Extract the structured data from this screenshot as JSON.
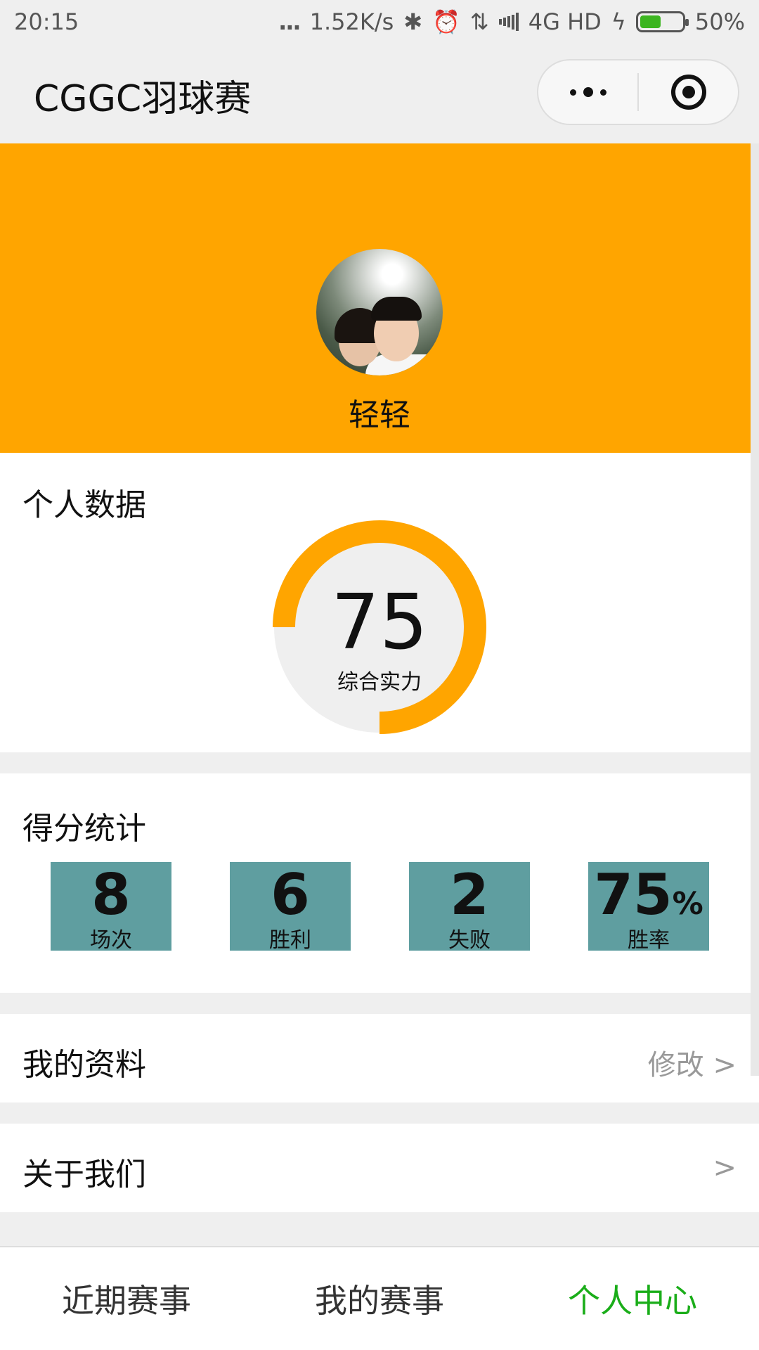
{
  "status_bar": {
    "time": "20:15",
    "dots": "...",
    "speed": "1.52K/s",
    "network": "4G HD",
    "battery": "50%",
    "battery_level": 0.5,
    "icons": [
      "bluetooth-icon",
      "alarm-icon",
      "data-arrows-icon",
      "signal-icon",
      "charging-icon",
      "battery-icon"
    ]
  },
  "header": {
    "title": "CGGC羽球赛",
    "capsule_icons": [
      "more-icon",
      "close-mini-program-icon"
    ]
  },
  "profile": {
    "name": "轻轻",
    "banner_color": "#ffa500"
  },
  "personal_data": {
    "title": "个人数据",
    "strength_value": "75",
    "strength_label": "综合实力",
    "ring_fraction": 0.75,
    "ring_color": "#ffa500"
  },
  "score_stats": {
    "title": "得分统计",
    "box_color": "#5f9ea0",
    "items": [
      {
        "value": "8",
        "label": "场次"
      },
      {
        "value": "6",
        "label": "胜利"
      },
      {
        "value": "2",
        "label": "失败"
      },
      {
        "value": "75",
        "unit": "%",
        "label": "胜率"
      }
    ]
  },
  "rows": {
    "my_profile": {
      "title": "我的资料",
      "action": "修改 >"
    },
    "about_us": {
      "title": "关于我们",
      "action": ">"
    }
  },
  "tabs": [
    {
      "label": "近期赛事",
      "active": false
    },
    {
      "label": "我的赛事",
      "active": false
    },
    {
      "label": "个人中心",
      "active": true
    }
  ],
  "active_color": "#1aad19"
}
